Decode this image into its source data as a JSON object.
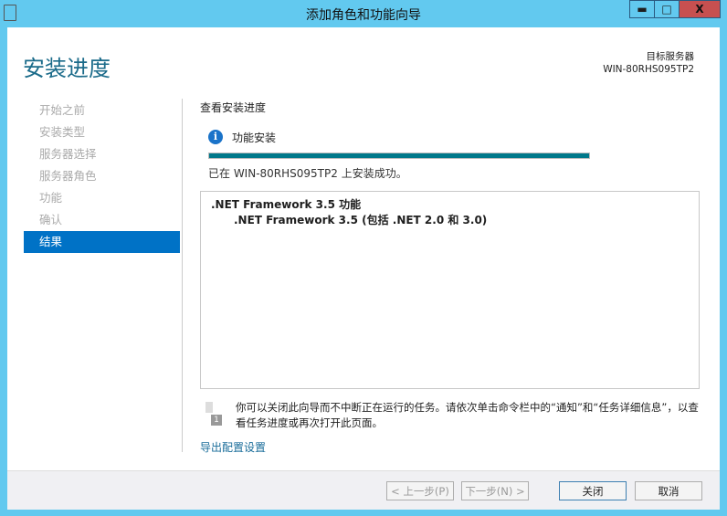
{
  "window": {
    "title": "添加角色和功能向导",
    "minimize": "▬",
    "maximize": "□",
    "close": "X"
  },
  "page": {
    "heading": "安装进度",
    "target_label": "目标服务器",
    "target_server": "WIN-80RHS095TP2"
  },
  "nav": [
    "开始之前",
    "安装类型",
    "服务器选择",
    "服务器角色",
    "功能",
    "确认",
    "结果"
  ],
  "main": {
    "section_title": "查看安装进度",
    "status_title": "功能安装",
    "progress": 1.0,
    "status_text": "已在 WIN-80RHS095TP2 上安装成功。",
    "results": [
      ".NET Framework 3.5 功能",
      ".NET Framework 3.5 (包括 .NET 2.0 和 3.0)"
    ],
    "note": "你可以关闭此向导而不中断正在运行的任务。请依次单击命令栏中的“通知”和“任务详细信息”，以查看任务进度或再次打开此页面。",
    "export_link": "导出配置设置"
  },
  "buttons": {
    "prev": "< 上一步(P)",
    "next": "下一步(N) >",
    "close": "关闭",
    "cancel": "取消"
  },
  "colors": {
    "accent": "#0072c6",
    "progress": "#00788a"
  }
}
